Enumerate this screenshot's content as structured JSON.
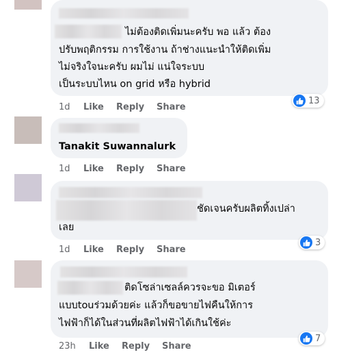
{
  "comments": [
    {
      "lines": [
        "ไม่ต้องติดเพิ่มนะครับ พอ แล้ว ต้อง",
        "ปรับพฤติกรรม การใช้งาน ถ้าช่างแนะนำให้ติดเพิ่ม",
        "ไม่จริงใจนะครับ ผมไม่ แน่ใจระบบ",
        "เป็นระบบไหน on grid หรือ hybrid"
      ],
      "time": "1d",
      "like": "Like",
      "reply": "Reply",
      "share": "Share",
      "reactions": "13"
    },
    {
      "name": "Tanakit Suwannalurk",
      "time": "1d",
      "like": "Like",
      "reply": "Reply",
      "share": "Share"
    },
    {
      "lines": [
        "ชัดเจนครับผลิตทิ้งเปล่า",
        "เลย"
      ],
      "time": "1d",
      "like": "Like",
      "reply": "Reply",
      "share": "Share",
      "reactions": "3"
    },
    {
      "lines": [
        "ติดโซล่าเซลล์ควรจะขอ มิเตอร์",
        "แบบtouร่วมด้วยค่ะ แล้วก็ขอขายไฟคืนให้การ",
        "ไฟฟ้าก็ได้ในส่วนที่ผลิตไฟฟ้าได้เกินใช้ค่ะ"
      ],
      "time": "23h",
      "like": "Like",
      "reply": "Reply",
      "share": "Share",
      "reactions": "7"
    }
  ],
  "colors": {
    "like_blue": "#1877f2",
    "bubble": "#f0f2f5",
    "meta": "#65676b"
  },
  "icons": {
    "reaction": "thumbs-up-icon"
  }
}
